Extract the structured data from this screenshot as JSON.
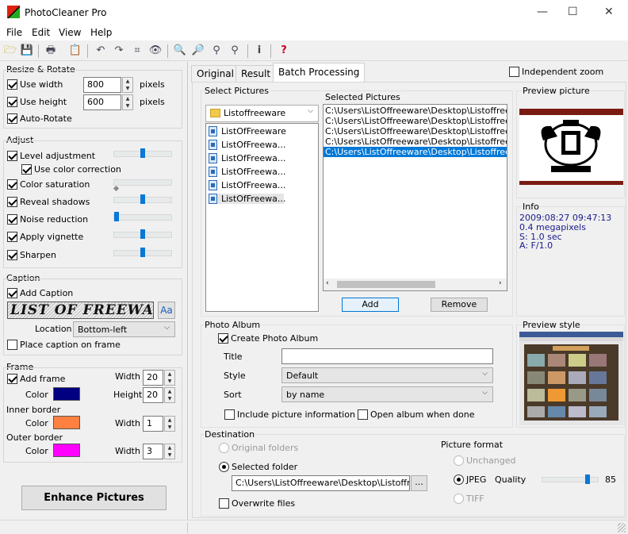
{
  "window": {
    "title": "PhotoCleaner Pro",
    "min": "—",
    "max": "☐",
    "close": "✕"
  },
  "menu": [
    "File",
    "Edit",
    "View",
    "Help"
  ],
  "toolbar": {
    "icons": [
      "open-folder",
      "save",
      "print",
      "copy",
      "undo",
      "redo",
      "crop",
      "eye",
      "zoom-in",
      "zoom-out",
      "zoom-fit",
      "zoom-actual",
      "info",
      "help"
    ],
    "glyphs": [
      "🗁",
      "💾",
      "🖶",
      "📋",
      "↶",
      "↷",
      "⌗",
      "👁",
      "🔍",
      "🔎",
      "⚲",
      "⚲",
      "i",
      "?"
    ]
  },
  "resize": {
    "title": "Resize & Rotate",
    "use_width": "Use width",
    "width": "800",
    "use_height": "Use height",
    "height": "600",
    "pixels": "pixels",
    "auto_rotate": "Auto-Rotate"
  },
  "adjust": {
    "title": "Adjust",
    "level": "Level adjustment",
    "color_correction": "Use color correction",
    "saturation": "Color saturation",
    "shadows": "Reveal shadows",
    "noise": "Noise reduction",
    "vignette": "Apply vignette",
    "sharpen": "Sharpen",
    "levels": {
      "level": 0.5,
      "saturation": 0.0,
      "shadows": 0.5,
      "noise": 0.0,
      "vignette": 0.5,
      "sharpen": 0.5
    }
  },
  "caption": {
    "title": "Caption",
    "add": "Add Caption",
    "preview": "LIST OF FREEWARE",
    "font_button": "Aa",
    "location_label": "Location",
    "location": "Bottom-left",
    "place_on_frame": "Place caption on frame"
  },
  "frame": {
    "title": "Frame",
    "add": "Add frame",
    "color": "Color",
    "width_label": "Width",
    "height_label": "Height",
    "width": "20",
    "height": "20",
    "inner": "Inner border",
    "inner_color": "Color",
    "inner_width_label": "Width",
    "inner_width": "1",
    "outer": "Outer border",
    "outer_color": "Color",
    "outer_width_label": "Width",
    "outer_width": "3",
    "colors": {
      "frame": "#000080",
      "inner": "#ff8040",
      "outer": "#ff00ff"
    }
  },
  "enhance": "Enhance Pictures",
  "tabs": [
    "Original",
    "Result",
    "Batch Processing"
  ],
  "independent_zoom": "Independent zoom",
  "select": {
    "title": "Select Pictures",
    "folder": "Listoffreeware",
    "files": [
      "ListOfFreeware",
      "ListOfFreewa...",
      "ListOfFreewa...",
      "ListOfFreewa...",
      "ListOfFreewa...",
      "ListOfFreewa..."
    ]
  },
  "selected": {
    "title": "Selected Pictures",
    "items": [
      "C:\\Users\\ListOffreeware\\Desktop\\Listoffreeware",
      "C:\\Users\\ListOffreeware\\Desktop\\Listoffreeware",
      "C:\\Users\\ListOffreeware\\Desktop\\Listoffreeware",
      "C:\\Users\\ListOffreeware\\Desktop\\Listoffreeware",
      "C:\\Users\\ListOffreeware\\Desktop\\Listoffreeware"
    ],
    "add": "Add",
    "remove": "Remove"
  },
  "preview": {
    "title": "Preview picture",
    "info_title": "Info",
    "info": [
      "2009:08:27 09:47:13",
      "0.4 megapixels",
      "S: 1.0 sec",
      "A: F/1.0"
    ],
    "style_title": "Preview style"
  },
  "album": {
    "title": "Photo Album",
    "create": "Create Photo Album",
    "title_label": "Title",
    "title_value": "",
    "style_label": "Style",
    "style": "Default",
    "sort_label": "Sort",
    "sort": "by name",
    "include_info": "Include picture information",
    "open_when_done": "Open album when done"
  },
  "destination": {
    "title": "Destination",
    "original": "Original folders",
    "selected": "Selected folder",
    "path": "C:\\Users\\ListOffreeware\\Desktop\\Listoffreew",
    "browse": "...",
    "overwrite": "Overwrite files"
  },
  "format": {
    "title": "Picture format",
    "unchanged": "Unchanged",
    "jpeg": "JPEG",
    "quality_label": "Quality",
    "quality": "85",
    "quality_level": 0.85,
    "tiff": "TIFF"
  }
}
